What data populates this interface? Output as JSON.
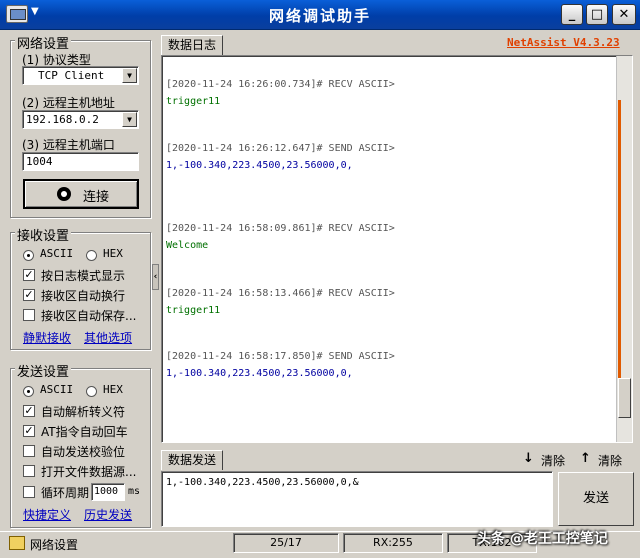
{
  "window": {
    "title": "网络调试助手",
    "drop": "▼",
    "min": "_",
    "max": "□",
    "close": "✕"
  },
  "net_settings": {
    "title": "网络设置",
    "protocol_label": "(1) 协议类型",
    "protocol_value": "TCP Client",
    "host_label": "(2) 远程主机地址",
    "host_value": "192.168.0.2",
    "port_label": "(3) 远程主机端口",
    "port_value": "1004",
    "connect_label": "连接"
  },
  "recv_settings": {
    "title": "接收设置",
    "ascii": "ASCII",
    "hex": "HEX",
    "opt1": "按日志模式显示",
    "opt2": "接收区自动换行",
    "opt3": "接收区自动保存...",
    "link1": "静默接收",
    "link2": "其他选项"
  },
  "send_settings": {
    "title": "发送设置",
    "ascii": "ASCII",
    "hex": "HEX",
    "opt1": "自动解析转义符",
    "opt2": "AT指令自动回车",
    "opt3": "自动发送校验位",
    "opt4": "打开文件数据源...",
    "opt5_label": "循环周期",
    "opt5_value": "1000",
    "opt5_unit": "ms",
    "link1": "快捷定义",
    "link2": "历史发送"
  },
  "log": {
    "tab": "数据日志",
    "brand": "NetAssist V4.3.23",
    "entries": [
      {
        "head": "[2020-11-24 16:26:00.734]# RECV ASCII>",
        "body": "trigger11",
        "kind": "recv"
      },
      {
        "head": "[2020-11-24 16:26:12.647]# SEND ASCII>",
        "body": "1,-100.340,223.4500,23.56000,0,",
        "kind": "send"
      },
      {
        "head": "[2020-11-24 16:58:09.861]# RECV ASCII>",
        "body": "Welcome",
        "kind": "recv"
      },
      {
        "head": "[2020-11-24 16:58:13.466]# RECV ASCII>",
        "body": "trigger11",
        "kind": "recv"
      },
      {
        "head": "[2020-11-24 16:58:17.850]# SEND ASCII>",
        "body": "1,-100.340,223.4500,23.56000,0,",
        "kind": "send"
      }
    ]
  },
  "send_area": {
    "tab": "数据发送",
    "clear1": "清除",
    "clear2": "清除",
    "value": "1,-100.340,223.4500,23.56000,0,&",
    "send_button": "发送"
  },
  "status": {
    "label": "网络设置",
    "counter": "25/17",
    "rx": "RX:255",
    "tx": "TX:102",
    "watermark": "头条 @老王工控笔记"
  }
}
